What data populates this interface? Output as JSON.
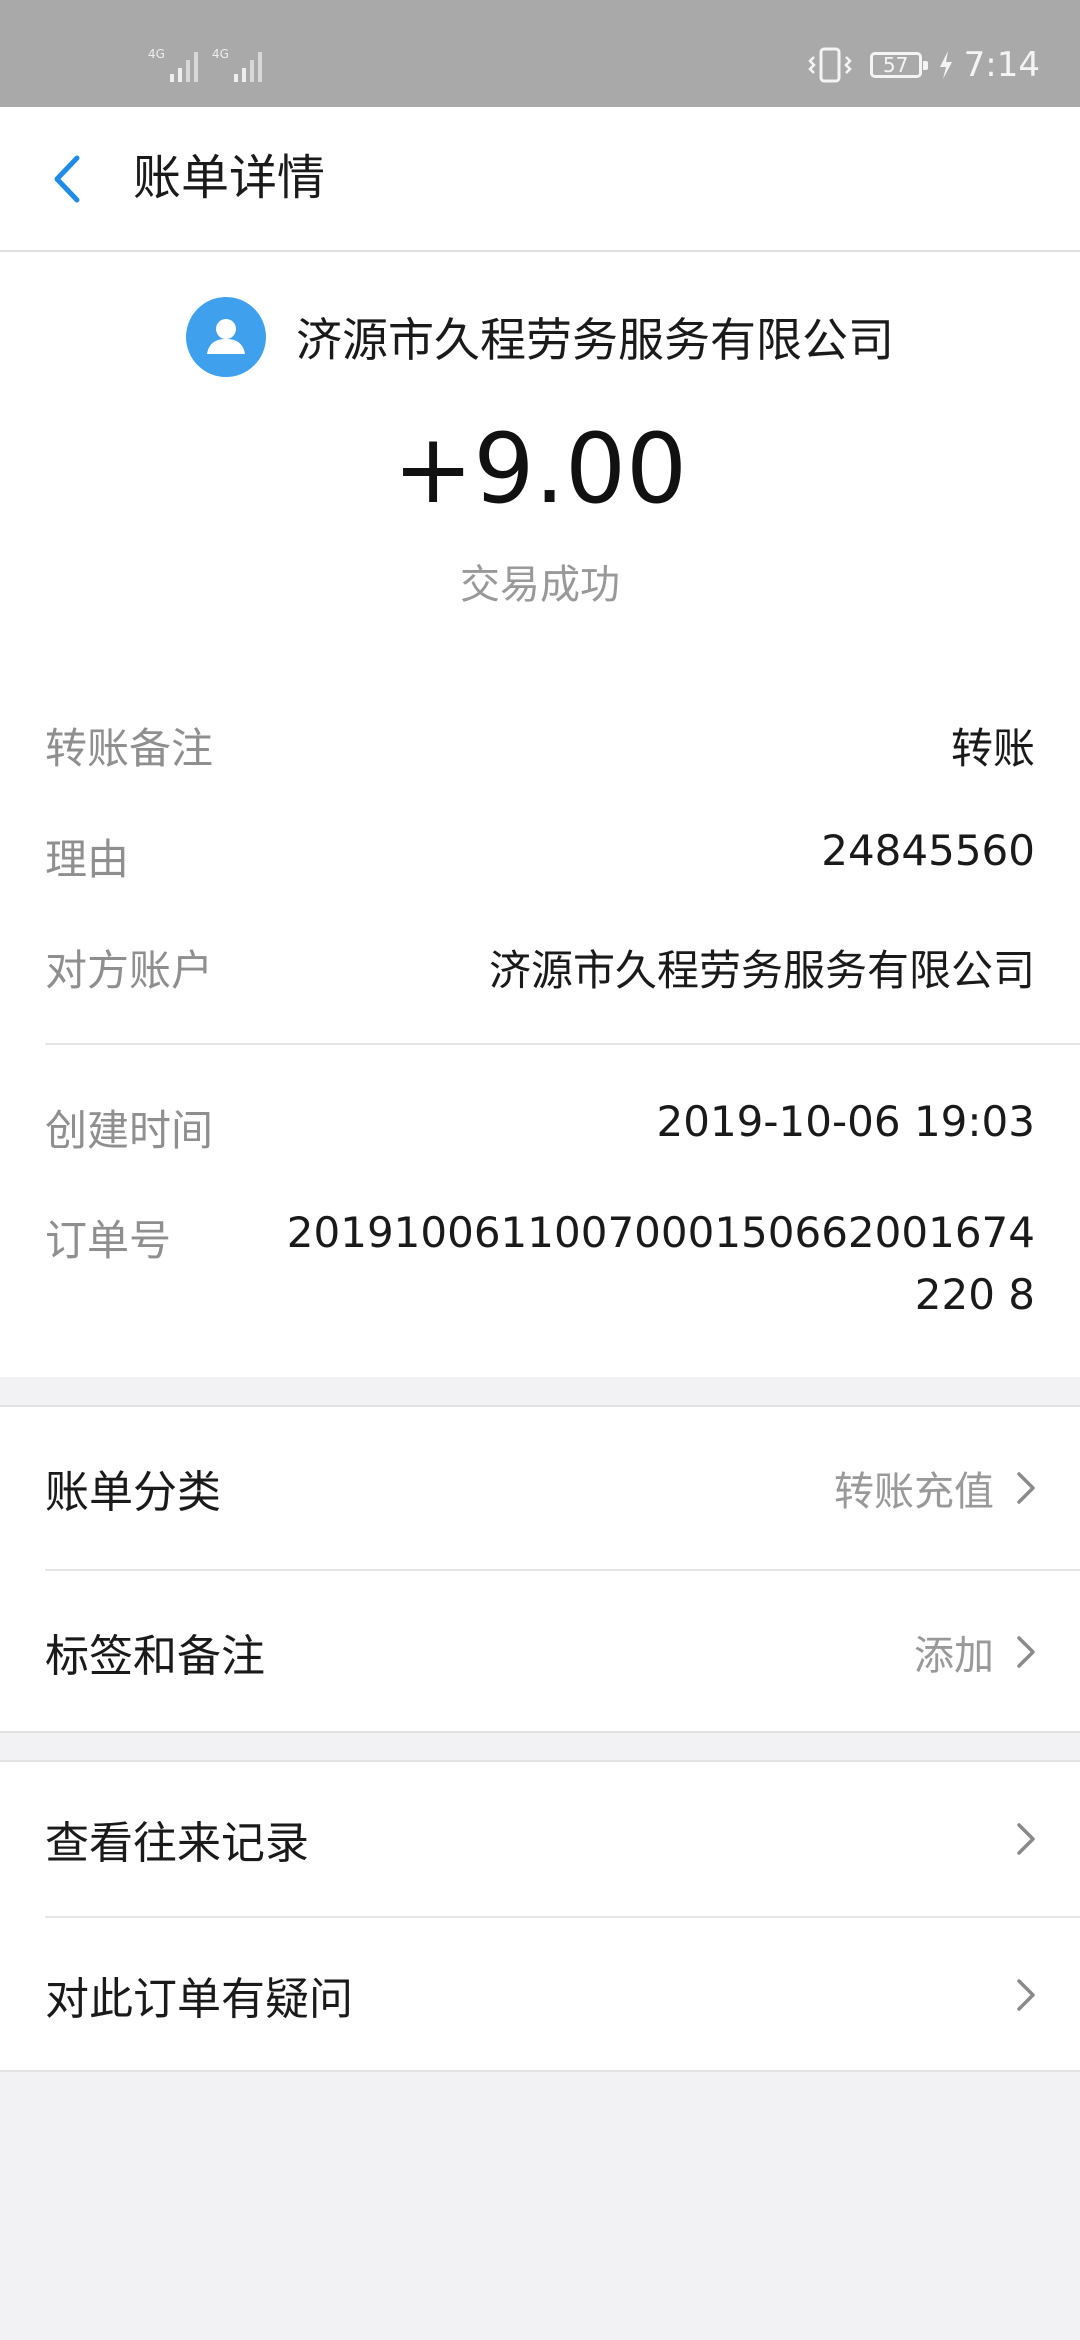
{
  "status_bar": {
    "network_1": "4G",
    "network_2": "4G",
    "battery": "57",
    "time": "7:14",
    "icons": [
      "signal-icon",
      "vibrate-icon",
      "battery-icon",
      "charging-icon"
    ]
  },
  "header": {
    "title": "账单详情",
    "back_icon": "chevron-left-icon"
  },
  "summary": {
    "merchant": "济源市久程劳务服务有限公司",
    "amount": "+9.00",
    "status": "交易成功"
  },
  "details": {
    "note_label": "转账备注",
    "note_value": "转账",
    "reason_label": "理由",
    "reason_value": "24845560",
    "account_label": "对方账户",
    "account_value": "济源市久程劳务服务有限公司",
    "created_label": "创建时间",
    "created_value": "2019-10-06 19:03",
    "order_label": "订单号",
    "order_value": "2019100611007000150662001674220 8"
  },
  "options": [
    {
      "label": "账单分类",
      "value": "转账充值"
    },
    {
      "label": "标签和备注",
      "value": "添加"
    }
  ],
  "actions": [
    {
      "label": "查看往来记录"
    },
    {
      "label": "对此订单有疑问"
    }
  ],
  "colors": {
    "status_bar": "#a9a9a9",
    "accent": "#1f8be8",
    "avatar": "#3fa0ee",
    "background": "#f2f2f5",
    "muted_text": "#999999"
  }
}
